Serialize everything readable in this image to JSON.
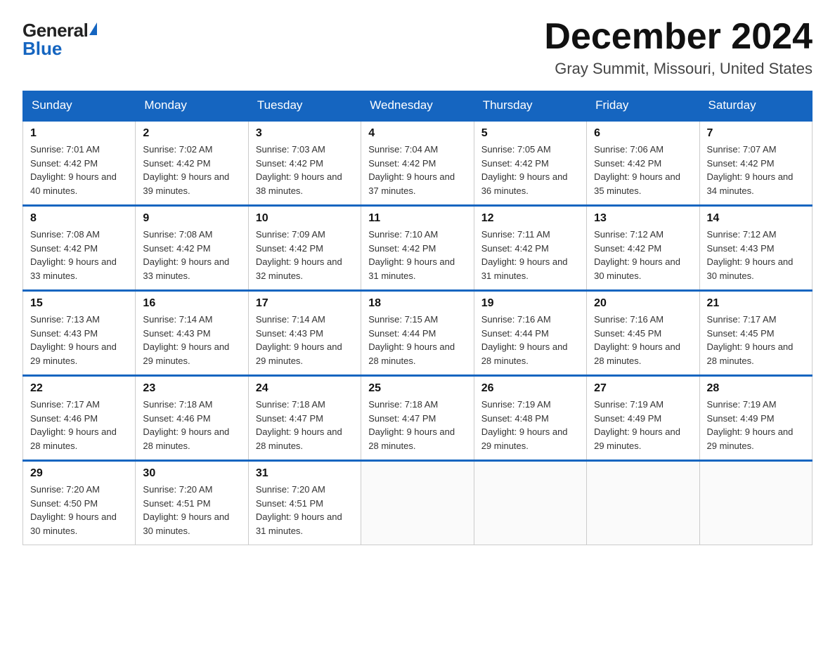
{
  "header": {
    "logo_general": "General",
    "logo_blue": "Blue",
    "month_year": "December 2024",
    "location": "Gray Summit, Missouri, United States"
  },
  "days_of_week": [
    "Sunday",
    "Monday",
    "Tuesday",
    "Wednesday",
    "Thursday",
    "Friday",
    "Saturday"
  ],
  "weeks": [
    [
      {
        "day": "1",
        "sunrise": "7:01 AM",
        "sunset": "4:42 PM",
        "daylight": "9 hours and 40 minutes."
      },
      {
        "day": "2",
        "sunrise": "7:02 AM",
        "sunset": "4:42 PM",
        "daylight": "9 hours and 39 minutes."
      },
      {
        "day": "3",
        "sunrise": "7:03 AM",
        "sunset": "4:42 PM",
        "daylight": "9 hours and 38 minutes."
      },
      {
        "day": "4",
        "sunrise": "7:04 AM",
        "sunset": "4:42 PM",
        "daylight": "9 hours and 37 minutes."
      },
      {
        "day": "5",
        "sunrise": "7:05 AM",
        "sunset": "4:42 PM",
        "daylight": "9 hours and 36 minutes."
      },
      {
        "day": "6",
        "sunrise": "7:06 AM",
        "sunset": "4:42 PM",
        "daylight": "9 hours and 35 minutes."
      },
      {
        "day": "7",
        "sunrise": "7:07 AM",
        "sunset": "4:42 PM",
        "daylight": "9 hours and 34 minutes."
      }
    ],
    [
      {
        "day": "8",
        "sunrise": "7:08 AM",
        "sunset": "4:42 PM",
        "daylight": "9 hours and 33 minutes."
      },
      {
        "day": "9",
        "sunrise": "7:08 AM",
        "sunset": "4:42 PM",
        "daylight": "9 hours and 33 minutes."
      },
      {
        "day": "10",
        "sunrise": "7:09 AM",
        "sunset": "4:42 PM",
        "daylight": "9 hours and 32 minutes."
      },
      {
        "day": "11",
        "sunrise": "7:10 AM",
        "sunset": "4:42 PM",
        "daylight": "9 hours and 31 minutes."
      },
      {
        "day": "12",
        "sunrise": "7:11 AM",
        "sunset": "4:42 PM",
        "daylight": "9 hours and 31 minutes."
      },
      {
        "day": "13",
        "sunrise": "7:12 AM",
        "sunset": "4:42 PM",
        "daylight": "9 hours and 30 minutes."
      },
      {
        "day": "14",
        "sunrise": "7:12 AM",
        "sunset": "4:43 PM",
        "daylight": "9 hours and 30 minutes."
      }
    ],
    [
      {
        "day": "15",
        "sunrise": "7:13 AM",
        "sunset": "4:43 PM",
        "daylight": "9 hours and 29 minutes."
      },
      {
        "day": "16",
        "sunrise": "7:14 AM",
        "sunset": "4:43 PM",
        "daylight": "9 hours and 29 minutes."
      },
      {
        "day": "17",
        "sunrise": "7:14 AM",
        "sunset": "4:43 PM",
        "daylight": "9 hours and 29 minutes."
      },
      {
        "day": "18",
        "sunrise": "7:15 AM",
        "sunset": "4:44 PM",
        "daylight": "9 hours and 28 minutes."
      },
      {
        "day": "19",
        "sunrise": "7:16 AM",
        "sunset": "4:44 PM",
        "daylight": "9 hours and 28 minutes."
      },
      {
        "day": "20",
        "sunrise": "7:16 AM",
        "sunset": "4:45 PM",
        "daylight": "9 hours and 28 minutes."
      },
      {
        "day": "21",
        "sunrise": "7:17 AM",
        "sunset": "4:45 PM",
        "daylight": "9 hours and 28 minutes."
      }
    ],
    [
      {
        "day": "22",
        "sunrise": "7:17 AM",
        "sunset": "4:46 PM",
        "daylight": "9 hours and 28 minutes."
      },
      {
        "day": "23",
        "sunrise": "7:18 AM",
        "sunset": "4:46 PM",
        "daylight": "9 hours and 28 minutes."
      },
      {
        "day": "24",
        "sunrise": "7:18 AM",
        "sunset": "4:47 PM",
        "daylight": "9 hours and 28 minutes."
      },
      {
        "day": "25",
        "sunrise": "7:18 AM",
        "sunset": "4:47 PM",
        "daylight": "9 hours and 28 minutes."
      },
      {
        "day": "26",
        "sunrise": "7:19 AM",
        "sunset": "4:48 PM",
        "daylight": "9 hours and 29 minutes."
      },
      {
        "day": "27",
        "sunrise": "7:19 AM",
        "sunset": "4:49 PM",
        "daylight": "9 hours and 29 minutes."
      },
      {
        "day": "28",
        "sunrise": "7:19 AM",
        "sunset": "4:49 PM",
        "daylight": "9 hours and 29 minutes."
      }
    ],
    [
      {
        "day": "29",
        "sunrise": "7:20 AM",
        "sunset": "4:50 PM",
        "daylight": "9 hours and 30 minutes."
      },
      {
        "day": "30",
        "sunrise": "7:20 AM",
        "sunset": "4:51 PM",
        "daylight": "9 hours and 30 minutes."
      },
      {
        "day": "31",
        "sunrise": "7:20 AM",
        "sunset": "4:51 PM",
        "daylight": "9 hours and 31 minutes."
      },
      null,
      null,
      null,
      null
    ]
  ]
}
